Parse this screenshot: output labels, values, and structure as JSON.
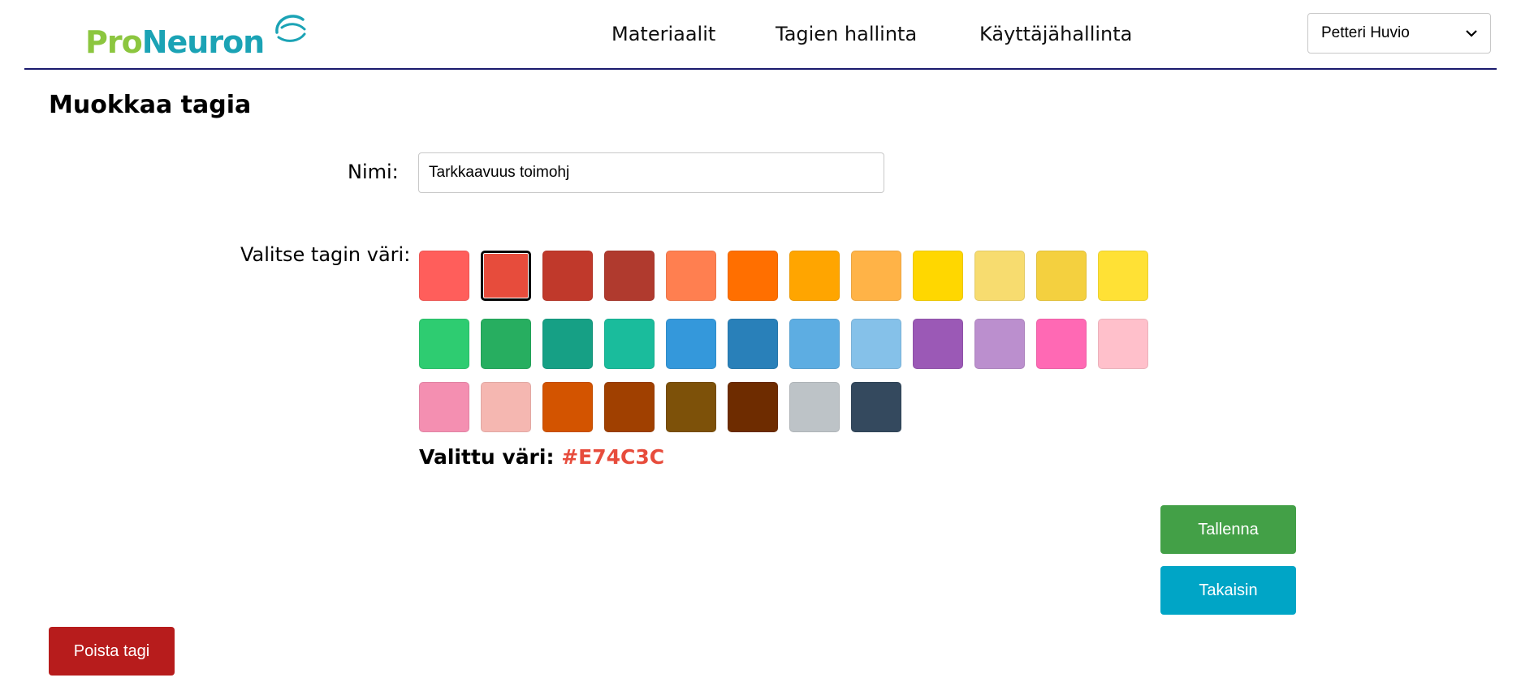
{
  "header": {
    "logo": {
      "part1": "Pro",
      "part2": "Neuron"
    },
    "nav": [
      {
        "label": "Materiaalit"
      },
      {
        "label": "Tagien hallinta"
      },
      {
        "label": "Käyttäjähallinta"
      }
    ],
    "user_select": {
      "selected": "Petteri Huvio"
    }
  },
  "page": {
    "title": "Muokkaa tagia",
    "name_label": "Nimi:",
    "name_value": "Tarkkaavuus toimohj",
    "color_label": "Valitse tagin väri:",
    "selected_label": "Valittu väri:",
    "selected_value": "#E74C3C",
    "selected_index": 1,
    "colors": [
      "#FF5E5B",
      "#E74C3C",
      "#C0392B",
      "#B03A2E",
      "#FF7F50",
      "#FF6F00",
      "#FFA500",
      "#FFB347",
      "#FFD700",
      "#F7DC6F",
      "#F4D03F",
      "#FFE135",
      "#2ECC71",
      "#27AE60",
      "#16A085",
      "#1ABC9C",
      "#3498DB",
      "#2980B9",
      "#5DADE2",
      "#85C1E9",
      "#9B59B6",
      "#BB8FCE",
      "#FF69B4",
      "#FFC0CB",
      "#F48FB1",
      "#F5B7B1",
      "#D35400",
      "#A04000",
      "#7D5109",
      "#6E2C00",
      "#BDC3C7",
      "#34495E"
    ]
  },
  "buttons": {
    "save": "Tallenna",
    "back": "Takaisin",
    "delete": "Poista tagi"
  }
}
